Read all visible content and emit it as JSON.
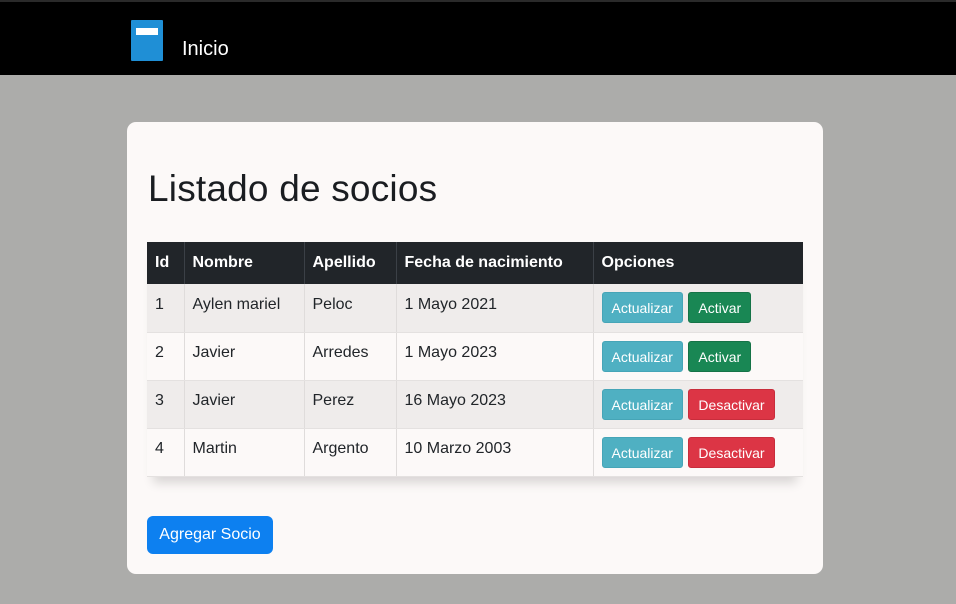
{
  "navbar": {
    "logo_icon": "book-icon",
    "home_label": "Inicio"
  },
  "page": {
    "title": "Listado de socios"
  },
  "table": {
    "headers": [
      "Id",
      "Nombre",
      "Apellido",
      "Fecha de nacimiento",
      "Opciones"
    ],
    "rows": [
      {
        "id": "1",
        "nombre": "Aylen mariel",
        "apellido": "Peloc",
        "fecha": "1 Mayo 2021",
        "update_label": "Actualizar",
        "toggle_label": "Activar",
        "toggle_type": "activate"
      },
      {
        "id": "2",
        "nombre": "Javier",
        "apellido": "Arredes",
        "fecha": "1 Mayo 2023",
        "update_label": "Actualizar",
        "toggle_label": "Activar",
        "toggle_type": "activate"
      },
      {
        "id": "3",
        "nombre": "Javier",
        "apellido": "Perez",
        "fecha": "16 Mayo 2023",
        "update_label": "Actualizar",
        "toggle_label": "Desactivar",
        "toggle_type": "deactivate"
      },
      {
        "id": "4",
        "nombre": "Martin",
        "apellido": "Argento",
        "fecha": "10 Marzo 2003",
        "update_label": "Actualizar",
        "toggle_label": "Desactivar",
        "toggle_type": "deactivate"
      }
    ]
  },
  "actions": {
    "add_label": "Agregar Socio"
  },
  "colors": {
    "navbar": "#000000",
    "background": "#acacaa",
    "card": "#fcf9f8",
    "info": "#4fb0c2",
    "success": "#198754",
    "danger": "#dc3545",
    "primary": "#0d80f0"
  }
}
